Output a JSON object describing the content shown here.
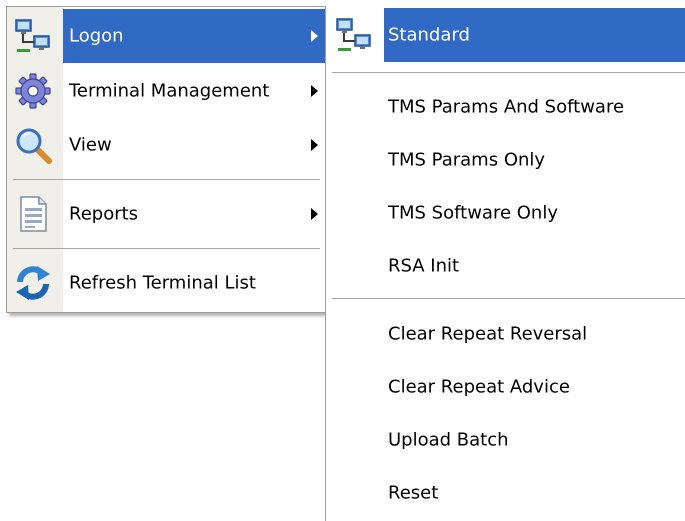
{
  "main_menu": {
    "items": [
      {
        "label": "Logon",
        "icon": "network-computers-icon",
        "has_submenu": true,
        "highlighted": true
      },
      {
        "label": "Terminal Management",
        "icon": "gear-icon",
        "has_submenu": true
      },
      {
        "label": "View",
        "icon": "magnifier-icon",
        "has_submenu": true
      },
      {
        "label": "Reports",
        "icon": "document-icon",
        "has_submenu": true
      },
      {
        "label": "Refresh Terminal List",
        "icon": "refresh-arrows-icon",
        "has_submenu": false
      }
    ]
  },
  "submenu": {
    "items": [
      {
        "label": "Standard",
        "icon": "network-computers-icon",
        "highlighted": true
      },
      {
        "label": "TMS Params And Software"
      },
      {
        "label": "TMS Params Only"
      },
      {
        "label": "TMS Software Only"
      },
      {
        "label": "RSA Init"
      },
      {
        "label": "Clear Repeat Reversal"
      },
      {
        "label": "Clear Repeat Advice"
      },
      {
        "label": "Upload Batch"
      },
      {
        "label": "Reset"
      }
    ]
  },
  "colors": {
    "highlight": "#316ac5",
    "icon_column": "#f0efea",
    "separator": "#a5a5a5"
  }
}
